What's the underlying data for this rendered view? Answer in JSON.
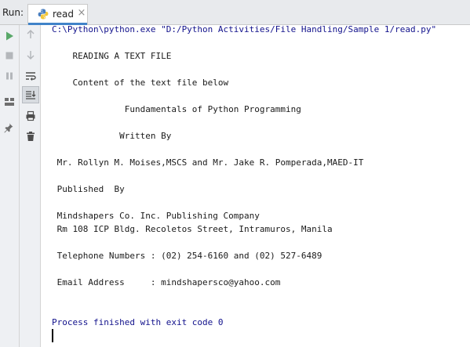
{
  "header": {
    "run_label": "Run:",
    "tab": {
      "label": "read",
      "close": "×"
    }
  },
  "toolbar": {
    "left": [
      {
        "name": "run",
        "icon": "play-icon"
      },
      {
        "name": "stop",
        "icon": "stop-icon"
      },
      {
        "name": "pause",
        "icon": "pause-icon"
      },
      {
        "name": "layout",
        "icon": "layout-icon"
      },
      {
        "name": "pin",
        "icon": "pin-icon"
      }
    ],
    "right": [
      {
        "name": "up",
        "icon": "arrow-up-icon"
      },
      {
        "name": "down",
        "icon": "arrow-down-icon"
      },
      {
        "name": "soft-wrap",
        "icon": "soft-wrap-icon"
      },
      {
        "name": "scroll-to-end",
        "icon": "scroll-to-end-icon"
      },
      {
        "name": "print",
        "icon": "print-icon"
      },
      {
        "name": "clear",
        "icon": "trash-icon"
      }
    ]
  },
  "console": {
    "command": "C:\\Python\\python.exe \"D:/Python Activities/File Handling/Sample 1/read.py\"",
    "lines": [
      "    READING A TEXT FILE",
      "    Content of the text file below",
      "              Fundamentals of Python Programming",
      "             Written By",
      " Mr. Rollyn M. Moises,MSCS and Mr. Jake R. Pomperada,MAED-IT",
      " Published  By",
      " Mindshapers Co. Inc. Publishing Company",
      " Rm 108 ICP Bldg. Recoletos Street, Intramuros, Manila",
      " Telephone Numbers : (02) 254-6160 and (02) 527-6489",
      " Email Address     : mindshapersco@yahoo.com"
    ],
    "exit_message": "Process finished with exit code 0"
  },
  "colors": {
    "run_green": "#59a869",
    "tab_underline": "#4083c9",
    "command_text": "#12128c"
  }
}
